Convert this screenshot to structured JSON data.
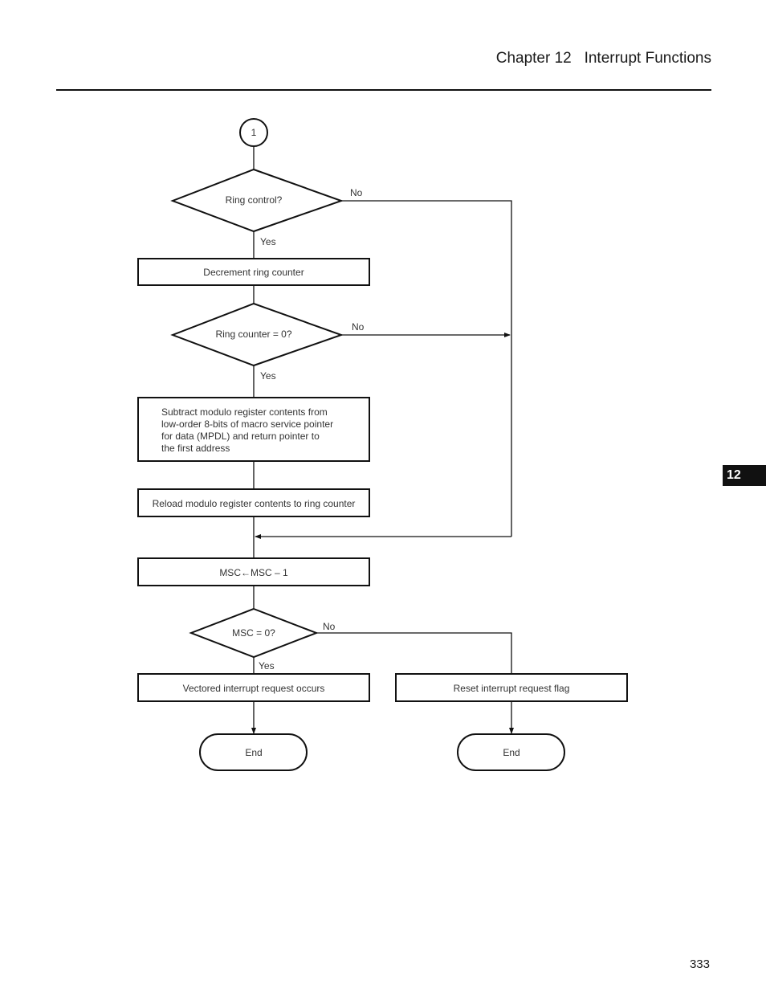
{
  "header": {
    "title": "Chapter 12   Interrupt Functions"
  },
  "chapter_tab": "12",
  "page_number": "333",
  "flowchart": {
    "connector_label": "1",
    "decision_ring_control": "Ring control?",
    "process_decrement": "Decrement ring counter",
    "decision_ring_counter_zero": "Ring counter = 0?",
    "process_subtract_lines": [
      "Subtract modulo register contents from",
      "low-order 8-bits of macro service pointer",
      "for data (MPDL) and return pointer to",
      "the first address"
    ],
    "process_reload": "Reload modulo register contents to ring counter",
    "process_msc_decrement": "MSC←MSC – 1",
    "decision_msc_zero": "MSC = 0?",
    "process_vectored": "Vectored interrupt request occurs",
    "process_reset_flag": "Reset interrupt request flag",
    "terminal_end_left": "End",
    "terminal_end_right": "End",
    "labels": {
      "yes": "Yes",
      "no": "No"
    }
  }
}
